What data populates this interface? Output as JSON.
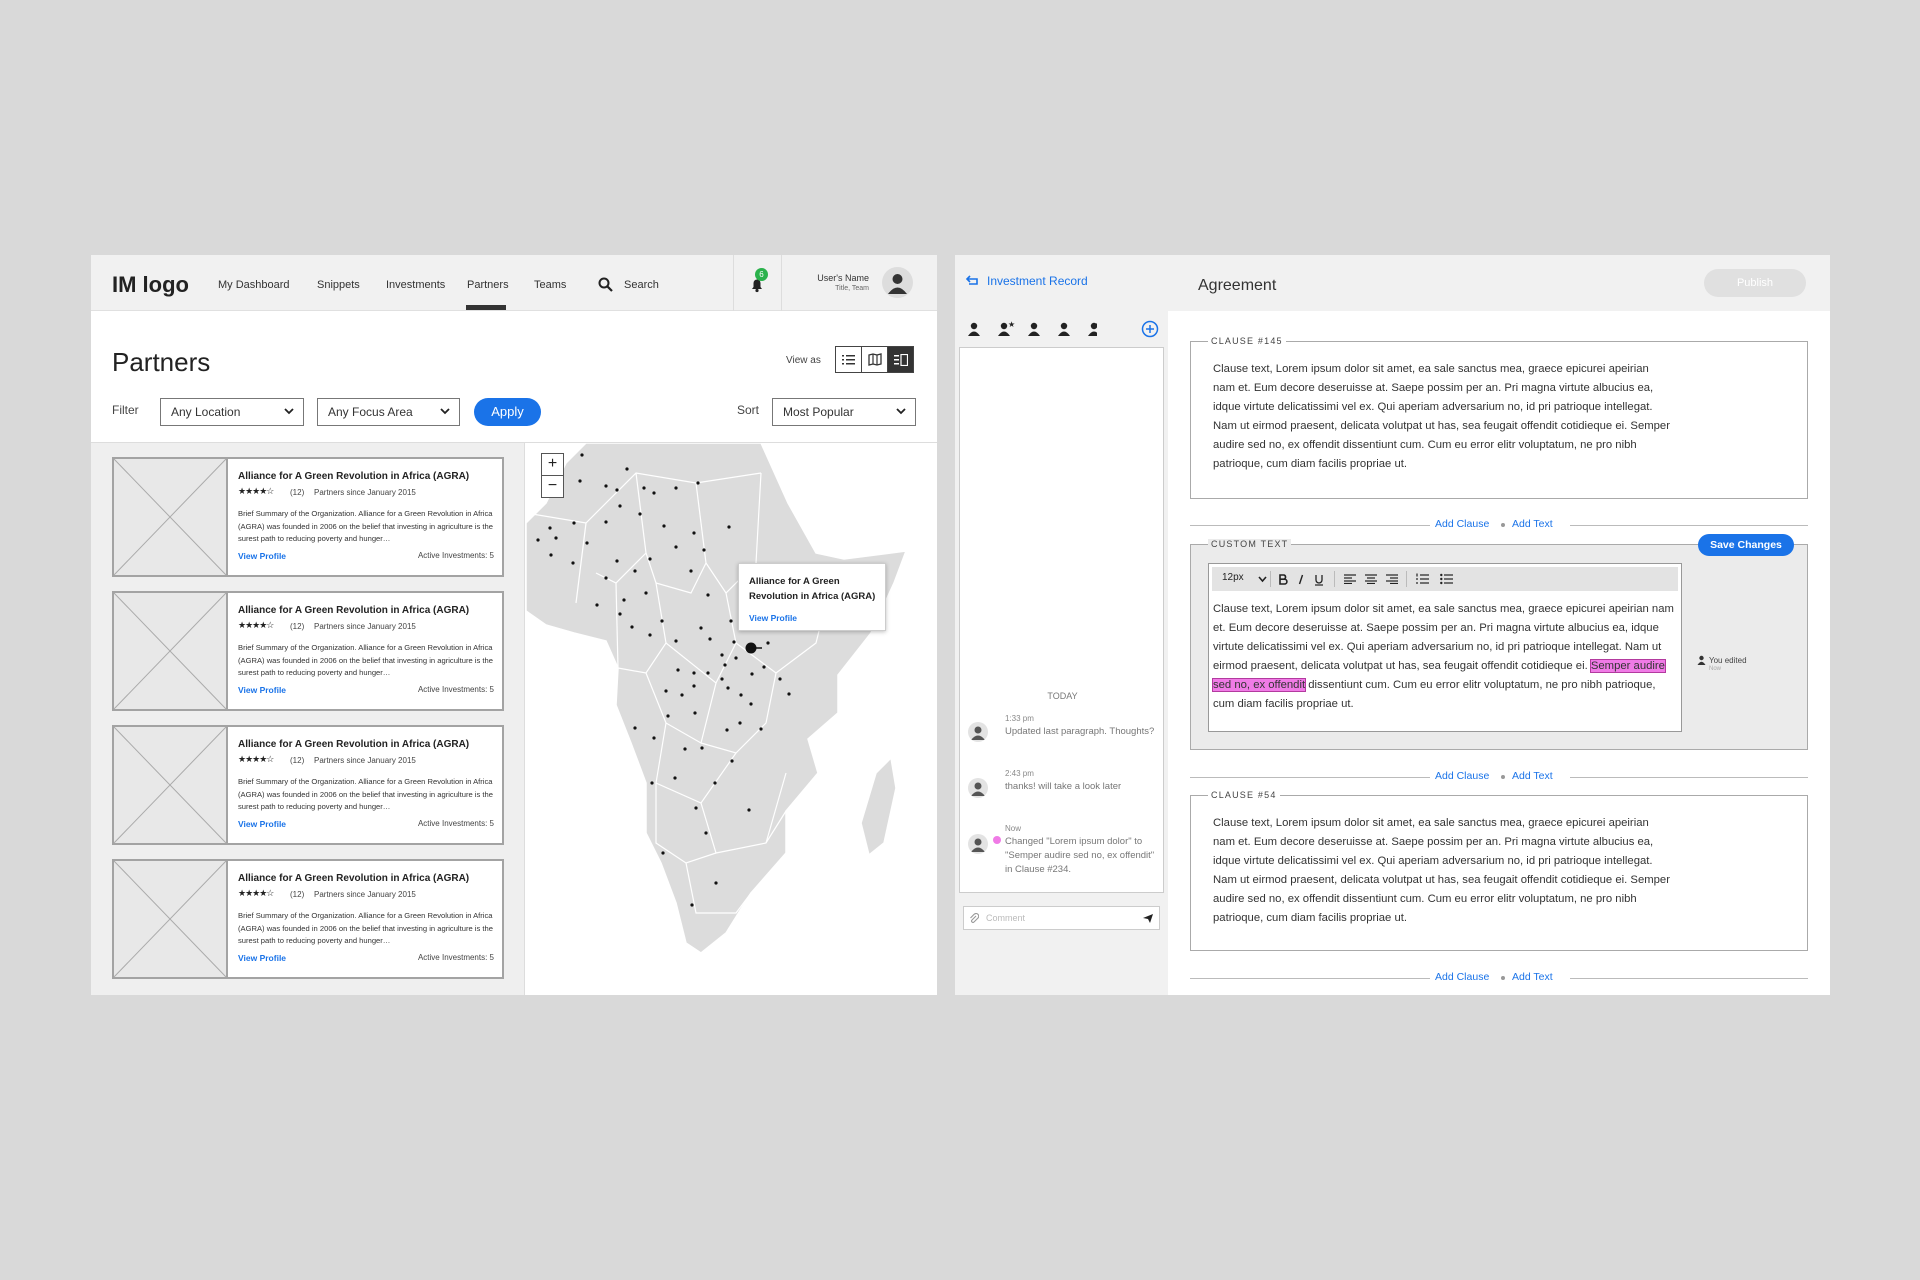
{
  "left_app": {
    "logo": "IM logo",
    "nav": [
      "My Dashboard",
      "Snippets",
      "Investments",
      "Partners",
      "Teams"
    ],
    "nav_active": "Partners",
    "search_label": "Search",
    "notification_count": "6",
    "user": {
      "name": "User's Name",
      "title": "Title, Team"
    },
    "page_title": "Partners",
    "view_as_label": "View as",
    "view_modes": [
      "list-icon",
      "map-icon",
      "split-view-icon"
    ],
    "view_active": "split-view-icon",
    "filter_label": "Filter",
    "filter_location": "Any Location",
    "filter_focus": "Any Focus Area",
    "apply_label": "Apply",
    "sort_label": "Sort",
    "sort_value": "Most Popular",
    "cards": [
      {
        "title": "Alliance for A Green Revolution in Africa (AGRA)",
        "stars": "★★★★☆",
        "reviews": "(12)",
        "since": "Partners since January 2015",
        "summary": "Brief Summary of the Organization. Alliance for a Green Revolution in Africa (AGRA) was founded in 2006 on the belief that investing in agriculture is the surest path to reducing poverty and hunger…",
        "view": "View Profile",
        "investments": "Active Investments: 5"
      },
      {
        "title": "Alliance for A Green Revolution in Africa (AGRA)",
        "stars": "★★★★☆",
        "reviews": "(12)",
        "since": "Partners since January 2015",
        "summary": "Brief Summary of the Organization. Alliance for a Green Revolution in Africa (AGRA) was founded in 2006 on the belief that investing in agriculture is the surest path to reducing poverty and hunger…",
        "view": "View Profile",
        "investments": "Active Investments: 5"
      },
      {
        "title": "Alliance for A Green Revolution in Africa (AGRA)",
        "stars": "★★★★☆",
        "reviews": "(12)",
        "since": "Partners since January 2015",
        "summary": "Brief Summary of the Organization. Alliance for a Green Revolution in Africa (AGRA) was founded in 2006 on the belief that investing in agriculture is the surest path to reducing poverty and hunger…",
        "view": "View Profile",
        "investments": "Active Investments: 5"
      },
      {
        "title": "Alliance for A Green Revolution in Africa (AGRA)",
        "stars": "★★★★☆",
        "reviews": "(12)",
        "since": "Partners since January 2015",
        "summary": "Brief Summary of the Organization. Alliance for a Green Revolution in Africa (AGRA) was founded in 2006 on the belief that investing in agriculture is the surest path to reducing poverty and hunger…",
        "view": "View Profile",
        "investments": "Active Investments: 5"
      }
    ],
    "map": {
      "zoom_in": "+",
      "zoom_out": "−",
      "popup_title": "Alliance for A Green Revolution in Africa (AGRA)",
      "popup_link": "View Profile"
    }
  },
  "right_app": {
    "back_label": "Investment Record",
    "title": "Agreement",
    "publish_label": "Publish",
    "today_label": "TODAY",
    "comments": [
      {
        "time": "1:33 pm",
        "text": "Updated last paragraph. Thoughts?"
      },
      {
        "time": "2:43 pm",
        "text": "thanks! will take a look later"
      },
      {
        "time": "Now",
        "text": "Changed \"Lorem ipsum dolor\" to \"Semper audire sed no, ex offendit\" in Clause #234."
      }
    ],
    "comment_placeholder": "Comment",
    "clause1_label": "CLAUSE #145",
    "clause_text": "Clause text, Lorem ipsum dolor sit amet, ea sale sanctus mea, graece epicurei apeirian nam et. Eum decore deseruisse at. Saepe possim per an. Pri magna virtute albucius ea, idque virtute delicatissimi vel ex. Qui aperiam adversarium no, id pri patrioque intellegat. Nam ut eirmod praesent, delicata volutpat ut has, sea feugait offendit cotidieque ei. Semper audire sed no, ex offendit dissentiunt cum. Cum eu error elitr voluptatum, ne pro nibh patrioque, cum diam facilis propriae ut.",
    "add_clause": "Add Clause",
    "add_text": "Add Text",
    "custom_label": "CUSTOM TEXT",
    "save_label": "Save Changes",
    "font_size": "12px",
    "custom_text_before": "Clause text, Lorem ipsum dolor sit amet, ea sale sanctus mea, graece epicurei apeirian nam et. Eum decore deseruisse at. Saepe possim per an. Pri magna virtute albucius ea, idque virtute delicatissimi vel ex. Qui aperiam adversarium no, id pri patrioque intellegat. Nam ut eirmod praesent, delicata volutpat ut has, sea feugait offendit cotidieque ei. ",
    "custom_text_highlight": "Semper audire sed no, ex offendit",
    "custom_text_after": " dissentiunt cum. Cum eu error elitr voluptatum, ne pro nibh patrioque, cum diam facilis propriae ut.",
    "edit_note": "You edited",
    "edit_note_time": "Now",
    "clause2_label": "CLAUSE #54"
  }
}
